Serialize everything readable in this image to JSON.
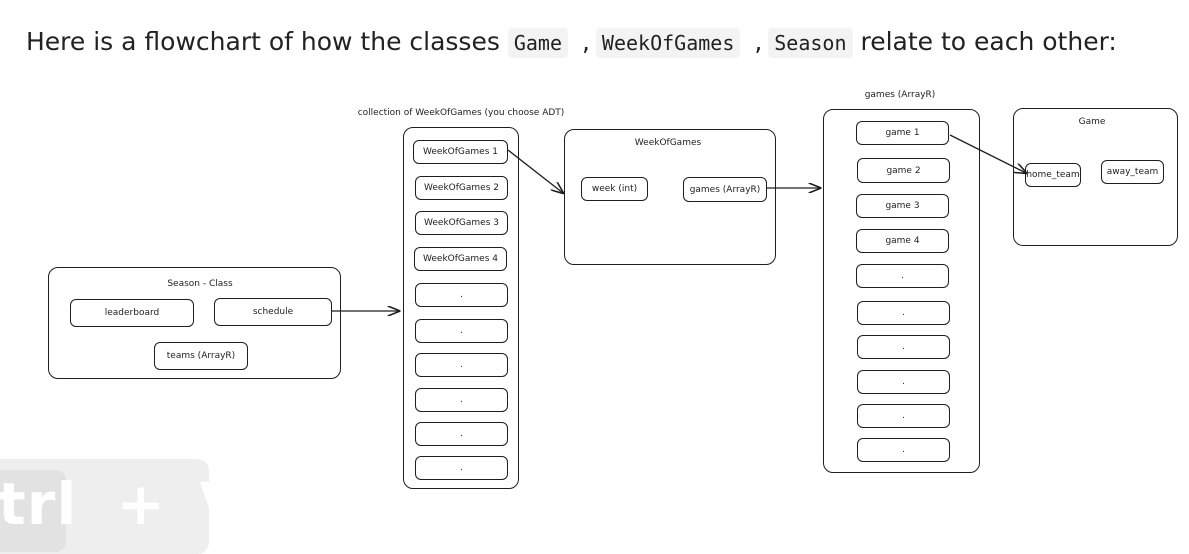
{
  "intro": {
    "text_before": "Here is a flowchart of how the classes",
    "class_1": "Game",
    "class_2": "WeekOfGames",
    "class_3": "Season",
    "separator": ",",
    "text_after": "relate to each other:"
  },
  "diagram": {
    "season": {
      "title": "Season - Class",
      "leaderboard": "leaderboard",
      "schedule": "schedule",
      "teams": "teams (ArrayR)"
    },
    "collection": {
      "title": "collection of WeekOfGames (you choose ADT)",
      "items": [
        "WeekOfGames 1",
        "WeekOfGames 2",
        "WeekOfGames 3",
        "WeekOfGames 4",
        ".",
        ".",
        ".",
        ".",
        ".",
        "."
      ]
    },
    "week_of_games": {
      "title": "WeekOfGames",
      "week": "week (int)",
      "games": "games (ArrayR)"
    },
    "games_array": {
      "title": "games (ArrayR)",
      "items": [
        "game 1",
        "game 2",
        "game 3",
        "game 4",
        ".",
        ".",
        ".",
        ".",
        ".",
        "."
      ]
    },
    "game": {
      "title": "Game",
      "home_team": "home_team",
      "away_team": "away_team"
    }
  },
  "watermark": {
    "key": "trl",
    "plus": "+",
    "letter": "V"
  }
}
